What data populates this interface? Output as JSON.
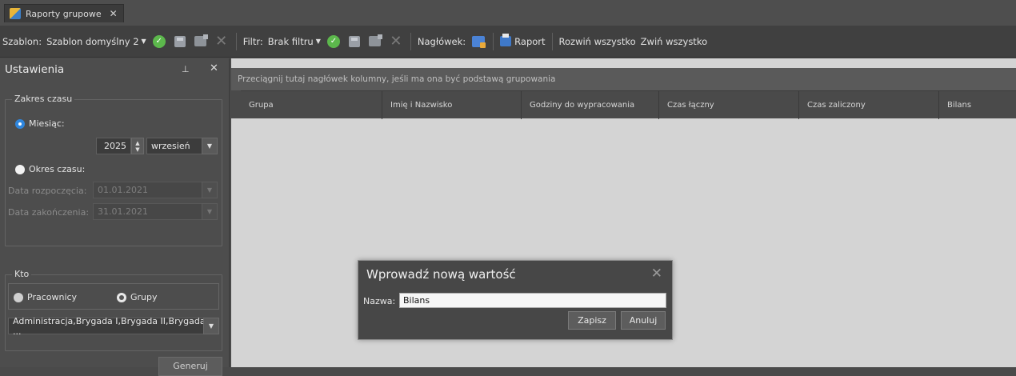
{
  "tab": {
    "title": "Raporty grupowe",
    "close": "✕"
  },
  "toolbar": {
    "template_label": "Szablon:",
    "template_value": "Szablon domyślny 2",
    "filter_label": "Filtr:",
    "filter_value": "Brak filtru",
    "header_label": "Nagłówek:",
    "report_label": "Raport",
    "expand_all": "Rozwiń wszystko",
    "collapse_all": "Zwiń wszystko"
  },
  "settings": {
    "title": "Ustawienia",
    "pin": "⊥",
    "close": "✕",
    "time_range": {
      "legend": "Zakres czasu",
      "month_label": "Miesiąc:",
      "year": "2025",
      "month": "wrzesień",
      "period_label": "Okres czasu:",
      "start_label": "Data rozpoczęcia:",
      "start_value": "01.01.2021",
      "end_label": "Data zakończenia:",
      "end_value": "31.01.2021"
    },
    "who": {
      "legend": "Kto",
      "employees_label": "Pracownicy",
      "groups_label": "Grupy",
      "selection": "Administracja,Brygada I,Brygada II,Brygada ..."
    },
    "generate_label": "Generuj"
  },
  "grid": {
    "group_hint": "Przeciągnij tutaj nagłówek kolumny, jeśli ma ona być podstawą grupowania",
    "columns": [
      "Grupa",
      "Imię i Nazwisko",
      "Godziny do wypracowania",
      "Czas łączny",
      "Czas zaliczony",
      "Bilans"
    ]
  },
  "dialog": {
    "title": "Wprowadź nową wartość",
    "close": "✕",
    "name_label": "Nazwa:",
    "name_value": "Bilans",
    "save_label": "Zapisz",
    "cancel_label": "Anuluj"
  }
}
